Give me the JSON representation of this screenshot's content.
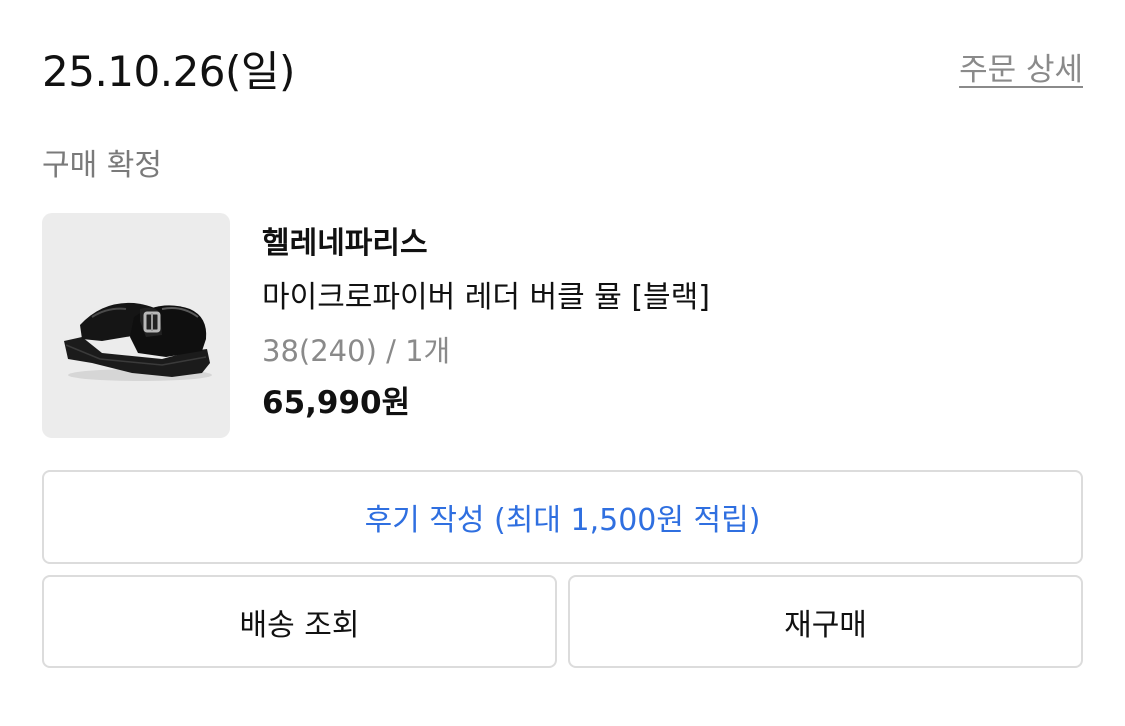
{
  "order": {
    "date": "25.10.26(일)",
    "detail_link": "주문 상세",
    "status": "구매 확정"
  },
  "product": {
    "image": "black-buckle-mule-shoe",
    "brand": "헬레네파리스",
    "name": "마이크로파이버 레더 버클 뮬 [블랙]",
    "option": "38(240) / 1개",
    "price": "65,990원"
  },
  "actions": {
    "review_label": "후기 작성 (최대 1,500원 적립)",
    "track_label": "배송 조회",
    "reorder_label": "재구매"
  },
  "colors": {
    "accent": "#2f6fe0",
    "muted_text": "#8a8a8a",
    "border": "#dcdcdc",
    "thumb_bg": "#ececec"
  }
}
